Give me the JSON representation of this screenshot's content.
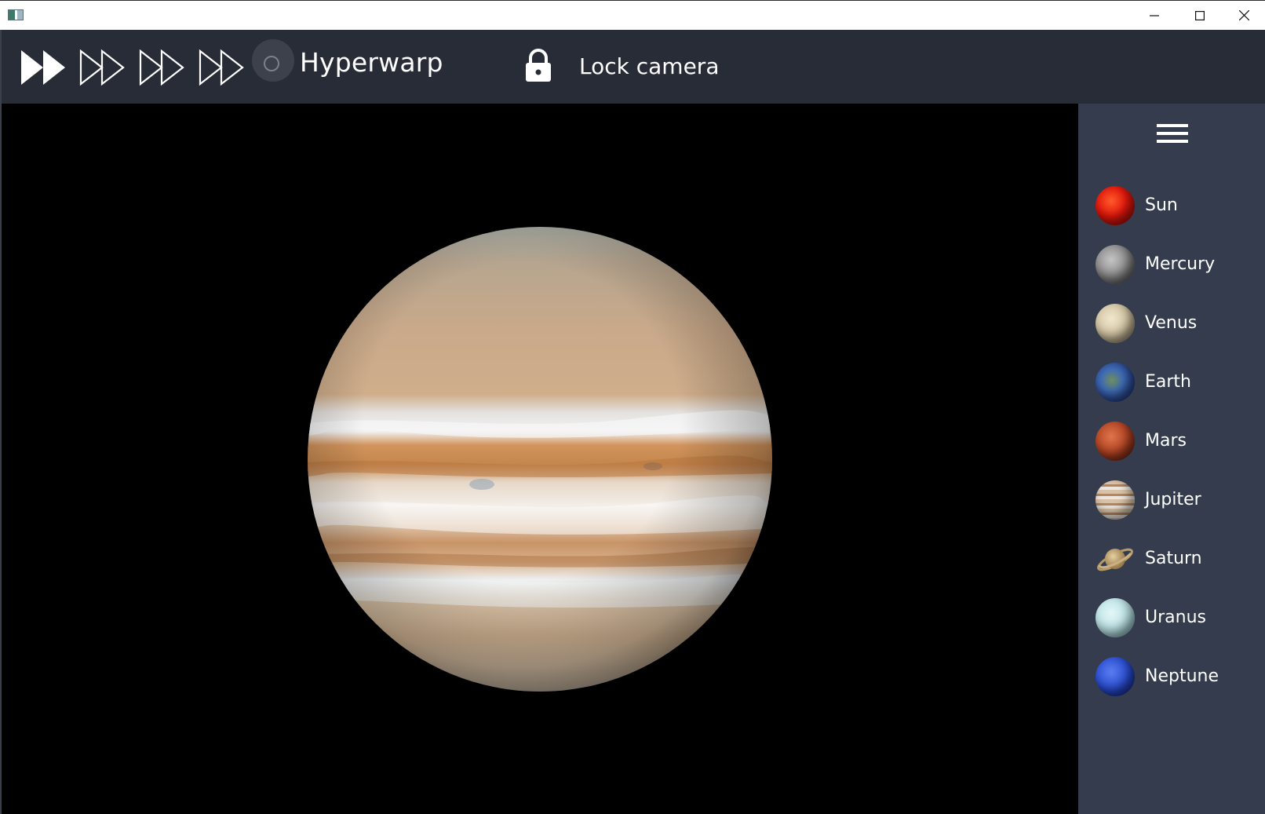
{
  "window": {
    "controls": [
      "minimize-icon",
      "maximize-icon",
      "close-icon"
    ]
  },
  "toolbar": {
    "speed_buttons": [
      {
        "icon": "fast-forward-filled-icon",
        "active": true
      },
      {
        "icon": "fast-forward-outline-icon",
        "active": false
      },
      {
        "icon": "fast-forward-outline-icon",
        "active": false
      },
      {
        "icon": "fast-forward-outline-icon",
        "active": false
      }
    ],
    "hyperwarp_label": "Hyperwarp",
    "hyperwarp_checked": false,
    "lock_label": "Lock camera",
    "lock_icon": "padlock-icon"
  },
  "viewport": {
    "planet": "Jupiter"
  },
  "sidebar": {
    "menu_icon": "hamburger-menu-icon",
    "items": [
      {
        "label": "Sun",
        "color": "#d41a0c"
      },
      {
        "label": "Mercury",
        "color": "#8e8e8e"
      },
      {
        "label": "Venus",
        "color": "#d9cdb0"
      },
      {
        "label": "Earth",
        "color": "#3b5ea8"
      },
      {
        "label": "Mars",
        "color": "#b24a2a"
      },
      {
        "label": "Jupiter",
        "color": "#c9a27f"
      },
      {
        "label": "Saturn",
        "color": "#c8a872"
      },
      {
        "label": "Uranus",
        "color": "#bfe3e6"
      },
      {
        "label": "Neptune",
        "color": "#2b4fd0"
      }
    ]
  },
  "colors": {
    "toolbar_bg": "#272c37",
    "sidebar_bg": "#343c4d",
    "viewport_bg": "#000000"
  }
}
